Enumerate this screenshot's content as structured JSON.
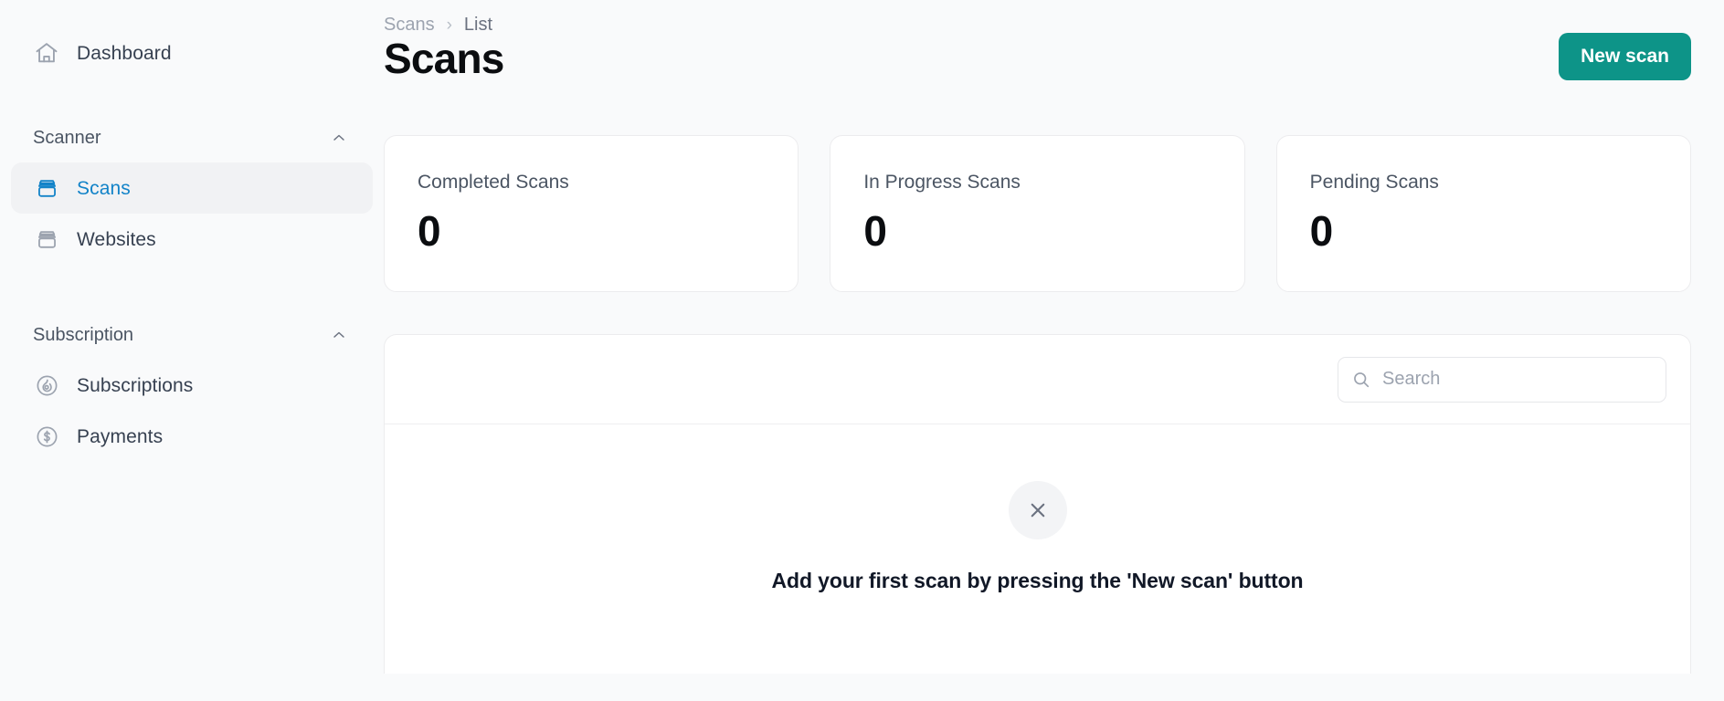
{
  "sidebar": {
    "top_items": [
      {
        "label": "Dashboard",
        "icon": "home-icon",
        "active": false
      }
    ],
    "groups": [
      {
        "title": "Scanner",
        "collapse_icon": "chevron-up-icon",
        "items": [
          {
            "label": "Scans",
            "icon": "archive-box-icon",
            "active": true
          },
          {
            "label": "Websites",
            "icon": "archive-box-icon",
            "active": false
          }
        ]
      },
      {
        "title": "Subscription",
        "collapse_icon": "chevron-up-icon",
        "items": [
          {
            "label": "Subscriptions",
            "icon": "flame-circle-icon",
            "active": false
          },
          {
            "label": "Payments",
            "icon": "dollar-circle-icon",
            "active": false
          }
        ]
      }
    ]
  },
  "header": {
    "breadcrumb": {
      "parent": "Scans",
      "separator": "›",
      "current": "List"
    },
    "title": "Scans",
    "primary_action": "New scan"
  },
  "stats": [
    {
      "label": "Completed Scans",
      "value": "0"
    },
    {
      "label": "In Progress Scans",
      "value": "0"
    },
    {
      "label": "Pending Scans",
      "value": "0"
    }
  ],
  "table_panel": {
    "search": {
      "placeholder": "Search",
      "value": "",
      "icon": "search-icon"
    },
    "empty_state": {
      "icon": "close-x-icon",
      "message": "Add your first scan by pressing the 'New scan' button"
    }
  },
  "colors": {
    "accent_primary": "#0d9488",
    "active_nav": "#1283c8",
    "page_bg": "#f9fafb",
    "card_bg": "#ffffff",
    "border": "#ececee",
    "muted_text": "#9ca3af"
  }
}
